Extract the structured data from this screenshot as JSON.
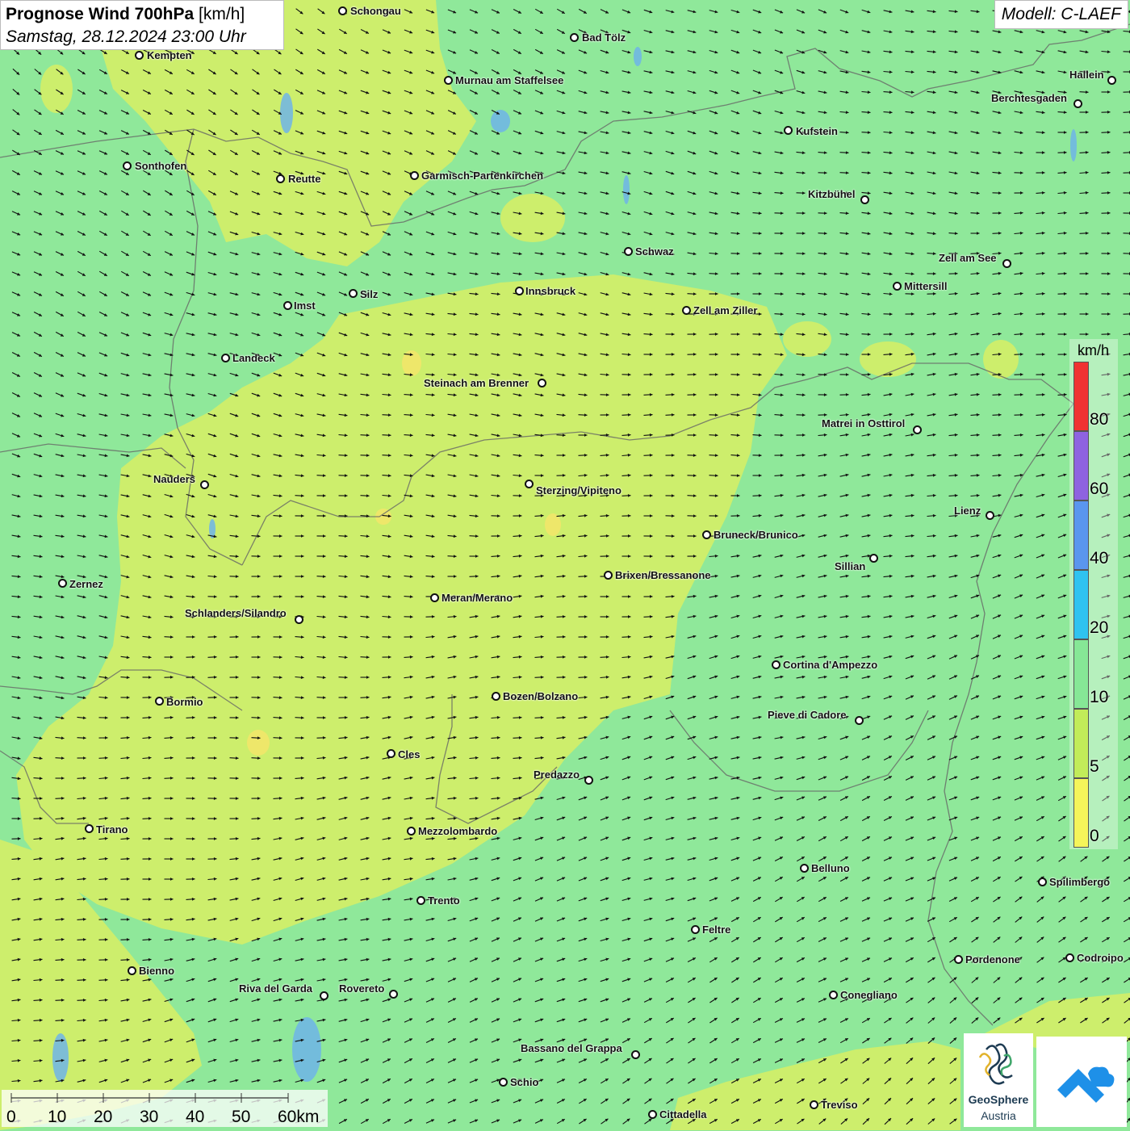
{
  "header": {
    "title_bold": "Prognose Wind 700hPa",
    "title_unit": "[km/h]",
    "datetime": "Samstag, 28.12.2024 23:00 Uhr"
  },
  "model": "Modell: C-LAEF",
  "legend": {
    "unit": "km/h",
    "labels": [
      "80",
      "60",
      "40",
      "20",
      "10",
      "5",
      "0"
    ],
    "colors": [
      "#f03232",
      "#8e63e0",
      "#5a96ee",
      "#2fc3f0",
      "#86e796",
      "#c2ec59",
      "#f5f55a"
    ]
  },
  "scalebar": {
    "labels": [
      "0",
      "10",
      "20",
      "30",
      "40",
      "50",
      "60km"
    ]
  },
  "cities": [
    {
      "name": "Schongau"
    },
    {
      "name": "Bad Tölz"
    },
    {
      "name": "Kempten"
    },
    {
      "name": "Murnau am Staffelsee"
    },
    {
      "name": "Hallein"
    },
    {
      "name": "Berchtesgaden"
    },
    {
      "name": "Kufstein"
    },
    {
      "name": "Sonthofen"
    },
    {
      "name": "Reutte"
    },
    {
      "name": "Garmisch-Partenkirchen"
    },
    {
      "name": "Kitzbühel"
    },
    {
      "name": "Schwaz"
    },
    {
      "name": "Zell am See"
    },
    {
      "name": "Innsbruck"
    },
    {
      "name": "Mittersill"
    },
    {
      "name": "Silz"
    },
    {
      "name": "Imst"
    },
    {
      "name": "Zell am Ziller"
    },
    {
      "name": "Landeck"
    },
    {
      "name": "Steinach am Brenner"
    },
    {
      "name": "Matrei in Osttirol"
    },
    {
      "name": "Nauders"
    },
    {
      "name": "Sterzing/Vipiteno"
    },
    {
      "name": "Lienz"
    },
    {
      "name": "Bruneck/Brunico"
    },
    {
      "name": "Sillian"
    },
    {
      "name": "Zernez"
    },
    {
      "name": "Brixen/Bressanone"
    },
    {
      "name": "Meran/Merano"
    },
    {
      "name": "Schlanders/Silandro"
    },
    {
      "name": "Cortina d'Ampezzo"
    },
    {
      "name": "Bozen/Bolzano"
    },
    {
      "name": "Bormio"
    },
    {
      "name": "Pieve di Cadore"
    },
    {
      "name": "Cles"
    },
    {
      "name": "Predazzo"
    },
    {
      "name": "Tirano"
    },
    {
      "name": "Mezzolombardo"
    },
    {
      "name": "Belluno"
    },
    {
      "name": "Spilimbergo"
    },
    {
      "name": "Trento"
    },
    {
      "name": "Feltre"
    },
    {
      "name": "Pordenone"
    },
    {
      "name": "Codroipo"
    },
    {
      "name": "Bienno"
    },
    {
      "name": "Riva del Garda"
    },
    {
      "name": "Rovereto"
    },
    {
      "name": "Conegliano"
    },
    {
      "name": "Bassano del Grappa"
    },
    {
      "name": "Schio"
    },
    {
      "name": "Treviso"
    },
    {
      "name": "Cittadella"
    }
  ],
  "logos": {
    "geosphere_line1": "GeoSphere",
    "geosphere_line2": "Austria"
  }
}
